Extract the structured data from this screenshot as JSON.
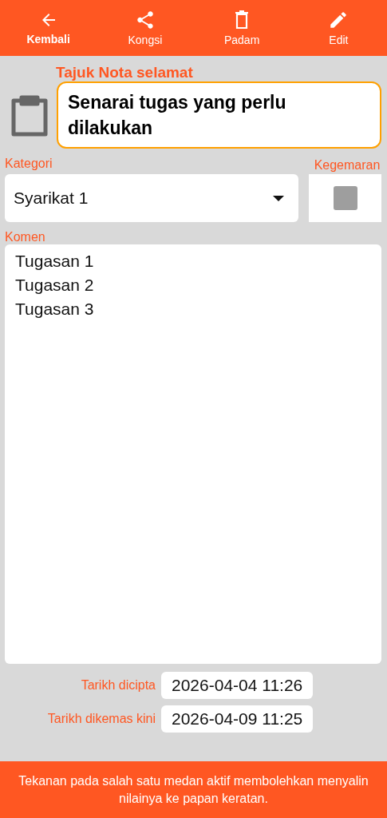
{
  "toolbar": [
    {
      "label": "Kembali",
      "selected": true
    },
    {
      "label": "Kongsi",
      "selected": false
    },
    {
      "label": "Padam",
      "selected": false
    },
    {
      "label": "Edit",
      "selected": false
    }
  ],
  "title": {
    "label": "Tajuk Nota selamat",
    "value": "Senarai tugas yang perlu dilakukan"
  },
  "category": {
    "label": "Kategori",
    "value": "Syarikat 1"
  },
  "favourite": {
    "label": "Kegemaran",
    "checked": false
  },
  "comment": {
    "label": "Komen",
    "value": "Tugasan 1\nTugasan 2\nTugasan 3"
  },
  "dates": [
    {
      "label": "Tarikh dicipta",
      "value": "2026-04-04 11:26"
    },
    {
      "label": "Tarikh dikemas kini",
      "value": "2026-04-09 11:25"
    }
  ],
  "footer": "Tekanan pada salah satu medan aktif membolehkan menyalin nilainya ke papan keratan."
}
